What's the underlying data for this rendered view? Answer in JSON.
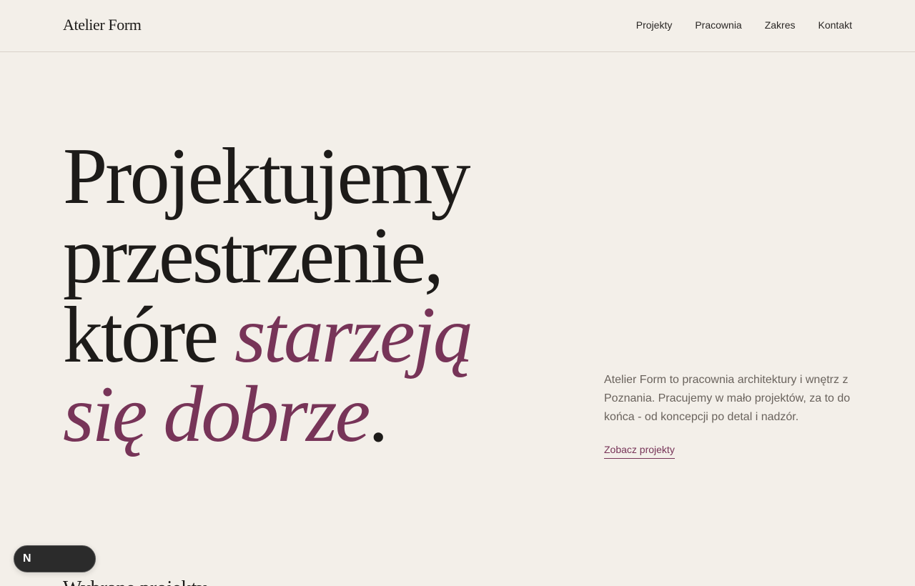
{
  "header": {
    "logo": "Atelier Form",
    "nav": [
      {
        "label": "Projekty"
      },
      {
        "label": "Pracownia"
      },
      {
        "label": "Zakres"
      },
      {
        "label": "Kontakt"
      }
    ]
  },
  "hero": {
    "title_line1": "Projektujemy",
    "title_line2": "przestrzenie,",
    "title_line3_plain": "które ",
    "title_line3_accent": "starzeją",
    "title_line4_accent": "się dobrze",
    "title_end": ".",
    "description": "Atelier Form to pracownia architektury i wnętrz z Poznania. Pracujemy w mało projektów, za to do końca - od koncepcji po detal i nadzór.",
    "cta_label": "Zobacz projekty"
  },
  "next_section": {
    "heading_partial": "Wybrane projekty"
  },
  "badge": {
    "icon_letter": "N"
  },
  "colors": {
    "background": "#f3efe9",
    "accent": "#773458",
    "text": "#1d1b19"
  }
}
